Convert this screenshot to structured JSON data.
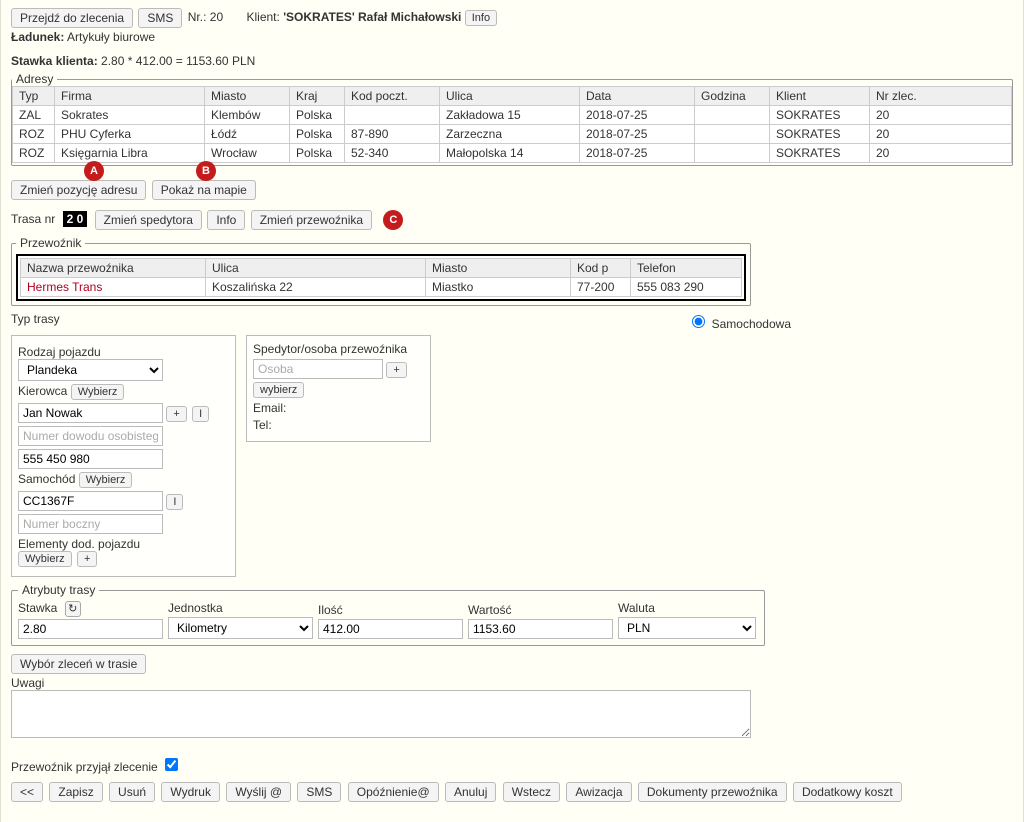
{
  "topbar": {
    "goto_order": "Przejdź do zlecenia",
    "sms": "SMS",
    "nr_label": "Nr.:",
    "nr_value": "20",
    "client_label": "Klient:",
    "client_name": "'SOKRATES' Rafał Michałowski",
    "info": "Info"
  },
  "cargo": {
    "label": "Ładunek:",
    "value": "Artykuły biurowe"
  },
  "rate": {
    "label": "Stawka klienta:",
    "value": "2.80 * 412.00 = 1153.60 PLN"
  },
  "addresses": {
    "legend": "Adresy",
    "headers": [
      "Typ",
      "Firma",
      "Miasto",
      "Kraj",
      "Kod poczt.",
      "Ulica",
      "Data",
      "Godzina",
      "Klient",
      "Nr zlec."
    ],
    "rows": [
      [
        "ZAL",
        "Sokrates",
        "Klembów",
        "Polska",
        "",
        "Zakładowa 15",
        "2018-07-25",
        "",
        "SOKRATES",
        "20"
      ],
      [
        "ROZ",
        "PHU Cyferka",
        "Łódź",
        "Polska",
        "87-890",
        "Zarzeczna",
        "2018-07-25",
        "",
        "SOKRATES",
        "20"
      ],
      [
        "ROZ",
        "Księgarnia Libra",
        "Wrocław",
        "Polska",
        "52-340",
        "Małopolska 14",
        "2018-07-25",
        "",
        "SOKRATES",
        "20"
      ]
    ],
    "badge_a": "A",
    "badge_b": "B"
  },
  "addr_buttons": {
    "change_pos": "Zmień pozycję adresu",
    "show_map": "Pokaż na mapie"
  },
  "route": {
    "label_prefix": "Trasa nr",
    "number": "2 0",
    "change_dispatcher": "Zmień spedytora",
    "info": "Info",
    "change_carrier": "Zmień przewoźnika",
    "badge_c": "C"
  },
  "carrier": {
    "legend": "Przewoźnik",
    "headers": [
      "Nazwa przewoźnika",
      "Ulica",
      "Miasto",
      "Kod p",
      "Telefon"
    ],
    "rows": [
      [
        "Hermes Trans",
        "Koszalińska 22",
        "Miastko",
        "77-200",
        "555 083 290"
      ]
    ]
  },
  "route_type": {
    "label": "Typ trasy",
    "radio_car": "Samochodowa"
  },
  "vehicle": {
    "kind_label": "Rodzaj pojazdu",
    "kind_value": "Plandeka",
    "driver_label": "Kierowca",
    "choose": "Wybierz",
    "driver_name": "Jan Nowak",
    "plus": "+",
    "i": "I",
    "id_placeholder": "Numer dowodu osobistego",
    "phone": "555 450 980",
    "car_label": "Samochód",
    "car_reg": "CC1367F",
    "side_placeholder": "Numer boczny",
    "extra_label": "Elementy dod. pojazdu"
  },
  "dispatcher": {
    "legend": "Spedytor/osoba przewoźnika",
    "person_placeholder": "Osoba",
    "choose": "wybierz",
    "email_label": "Email:",
    "tel_label": "Tel:"
  },
  "attrs": {
    "legend": "Atrybuty trasy",
    "rate_label": "Stawka",
    "rate_value": "2.80",
    "unit_label": "Jednostka",
    "unit_value": "Kilometry",
    "qty_label": "Ilość",
    "qty_value": "412.00",
    "value_label": "Wartość",
    "value_value": "1153.60",
    "currency_label": "Waluta",
    "currency_value": "PLN",
    "refresh": "↻"
  },
  "orders_in_route": "Wybór zleceń w trasie",
  "remarks_label": "Uwagi",
  "accepted_label": "Przewoźnik przyjął zlecenie",
  "footer": {
    "back": "<<",
    "save": "Zapisz",
    "delete": "Usuń",
    "print": "Wydruk",
    "send": "Wyślij @",
    "sms": "SMS",
    "delay": "Opóźnienie@",
    "cancel": "Anuluj",
    "prev": "Wstecz",
    "aviz": "Awizacja",
    "docs": "Dokumenty przewoźnika",
    "extra_cost": "Dodatkowy koszt"
  }
}
